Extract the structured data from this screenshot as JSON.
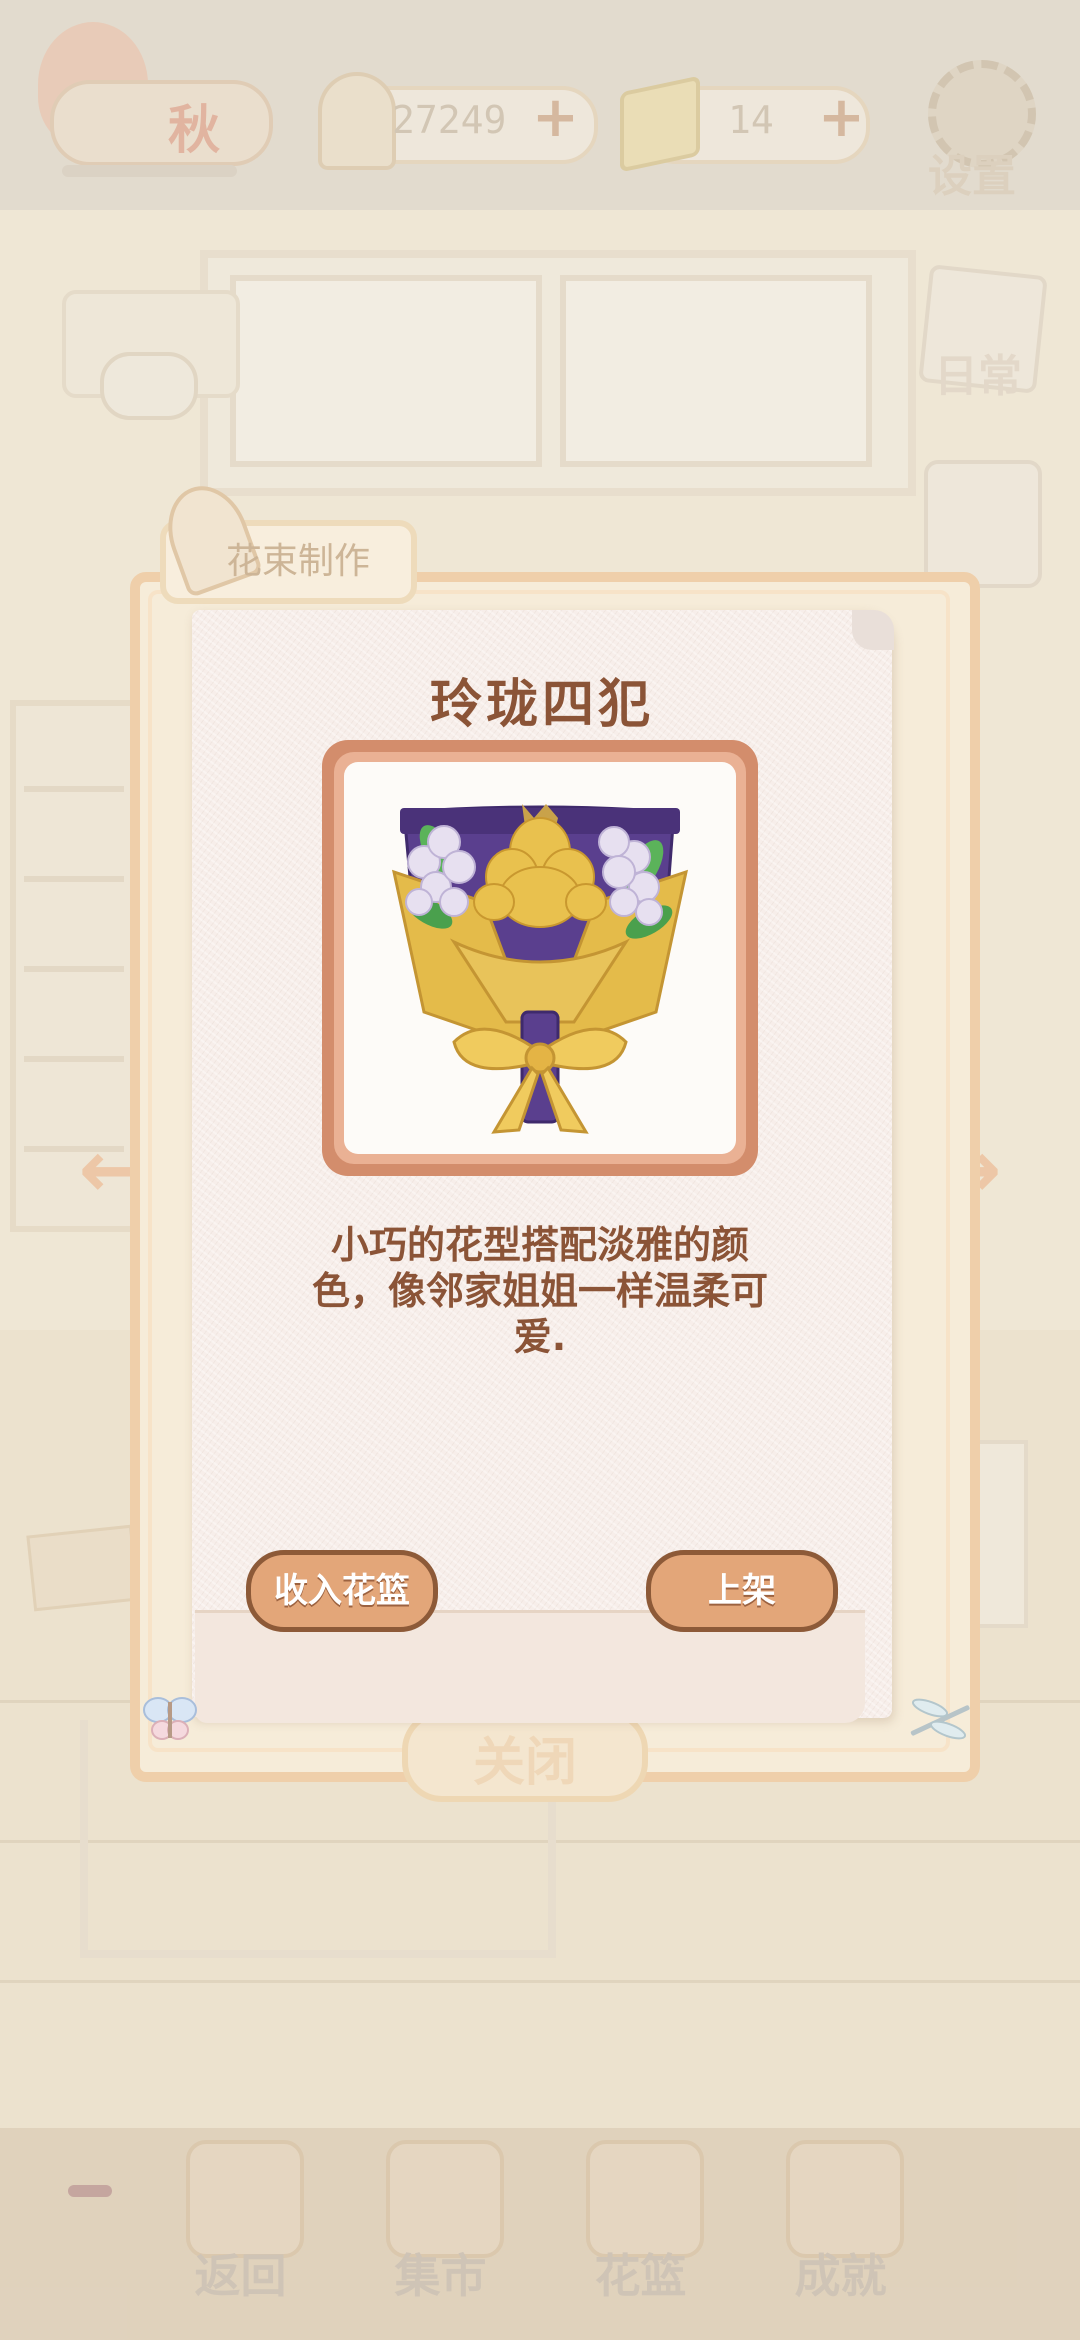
{
  "header": {
    "season": "秋",
    "fish_currency": "27249",
    "cheese_currency": "14",
    "settings_label": "设置"
  },
  "side_menu": {
    "daily_label": "日常"
  },
  "dialog": {
    "tab_title": "花束制作",
    "flower_name": "玲珑四犯",
    "description": "小巧的花型搭配淡雅的颜色，像邻家姐姐一样温柔可爱.",
    "collect_button": "收入花篮",
    "shelf_button": "上架",
    "close_button": "关闭"
  },
  "bottom_nav": [
    {
      "label": "返回",
      "icon": "window-icon"
    },
    {
      "label": "集市",
      "icon": "market-stall-icon"
    },
    {
      "label": "花篮",
      "icon": "flower-basket-icon"
    },
    {
      "label": "成就",
      "icon": "trophy-icon"
    }
  ],
  "colors": {
    "paper": "#f7eeea",
    "title_text": "#8b5437",
    "button_fill": "#e3a679",
    "button_border": "#8d5a38",
    "bouquet_wrap": "#5a3f8e",
    "bouquet_gold": "#e4bb4a"
  }
}
